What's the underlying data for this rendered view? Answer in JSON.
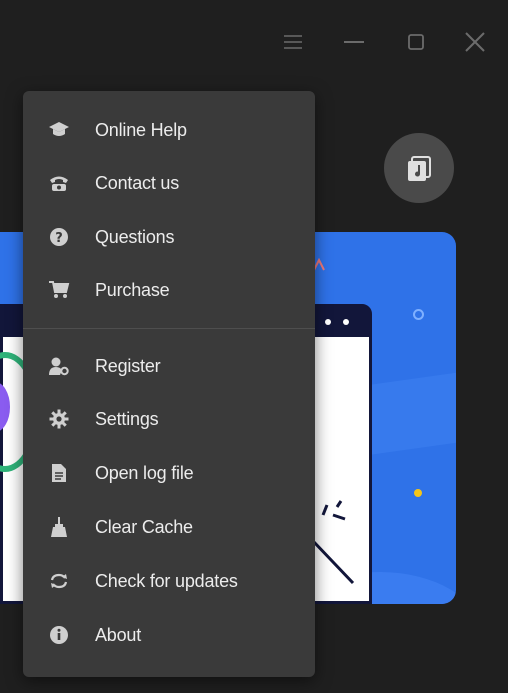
{
  "titlebar": {
    "icons": [
      "menu-icon",
      "minimize-icon",
      "maximize-icon",
      "close-icon"
    ]
  },
  "music_button": {
    "icon": "music-file-icon"
  },
  "menu": {
    "groups": [
      [
        {
          "label": "Online Help",
          "icon": "graduation-cap-icon"
        },
        {
          "label": "Contact us",
          "icon": "phone-icon"
        },
        {
          "label": "Questions",
          "icon": "question-icon"
        },
        {
          "label": "Purchase",
          "icon": "cart-icon"
        }
      ],
      [
        {
          "label": "Register",
          "icon": "user-key-icon"
        },
        {
          "label": "Settings",
          "icon": "gear-icon"
        },
        {
          "label": "Open log file",
          "icon": "document-icon"
        },
        {
          "label": "Clear Cache",
          "icon": "broom-icon"
        },
        {
          "label": "Check for updates",
          "icon": "refresh-icon"
        },
        {
          "label": "About",
          "icon": "info-icon"
        }
      ]
    ]
  },
  "colors": {
    "background": "#1f1f1f",
    "menu": "#3a3a3a",
    "hero": "#2f72e8",
    "accent_dot": "#f5c518"
  }
}
